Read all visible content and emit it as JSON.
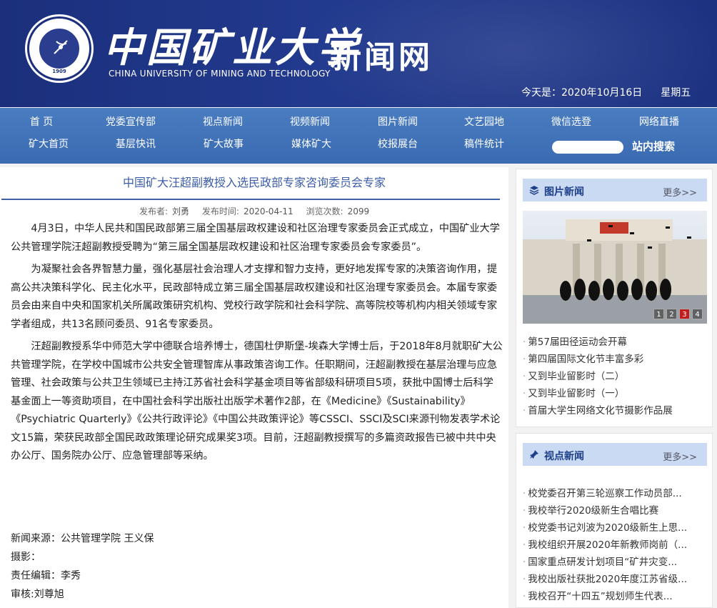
{
  "header": {
    "logo_cn": "中国矿业大学",
    "logo_en": "CHINA UNIVERSITY OF MINING AND TECHNOLOGY",
    "seal_year": "1909",
    "site_name": "新闻网",
    "date_prefix": "今天是：2020年10月16日",
    "weekday": "星期五"
  },
  "nav": {
    "row1": [
      "首 页",
      "党委宣传部",
      "视点新闻",
      "视频新闻",
      "图片新闻",
      "文艺园地",
      "微信选登",
      "网络直播"
    ],
    "row2": [
      "矿大首页",
      "基层快讯",
      "矿大故事",
      "媒体矿大",
      "校报展台",
      "稿件统计"
    ],
    "search_placeholder": "",
    "search_label": "站内搜索"
  },
  "article": {
    "title": "中国矿大汪超副教授入选民政部专家咨询委员会专家",
    "meta": {
      "author_label": "发布者:",
      "author": "刘勇",
      "time_label": "发布时间:",
      "time": "2020-04-11",
      "views_label": "浏览次数:",
      "views": "2099"
    },
    "paragraphs": [
      "4月3日，中华人民共和国民政部第三届全国基层政权建设和社区治理专家委员会正式成立，中国矿业大学公共管理学院汪超副教授受聘为“第三届全国基层政权建设和社区治理专家委员会专家委员”。",
      "为凝聚社会各界智慧力量，强化基层社会治理人才支撑和智力支持，更好地发挥专家的决策咨询作用，提高公共决策科学化、民主化水平，民政部特成立第三届全国基层政权建设和社区治理专家委员会。本届专家委员会由来自中央和国家机关所属政策研究机构、党校行政学院和社会科学院、高等院校等机构内相关领域专家学者组成，共13名顾问委员、91名专家委员。",
      "汪超副教授系华中师范大学中德联合培养博士，德国杜伊斯堡-埃森大学博士后，于2018年8月就职矿大公共管理学院，在学校中国城市公共安全管理智库从事政策咨询工作。任职期间，汪超副教授在基层治理与应急管理、社会政策与公共卫生领域已主持江苏省社会科学基金项目等省部级科研项目5项，获批中国博士后科学基金面上一等资助项目，在中国社会科学出版社出版学术著作2部，在《Medicine》《Sustainability》《Psychiatric Quarterly》《公共行政评论》《中国公共政策评论》等CSSCI、SSCI及SCI来源刊物发表学术论文15篇，荣获民政部全国民政政策理论研究成果奖3项。目前，汪超副教授撰写的多篇资政报告已被中共中央办公厅、国务院办公厅、应急管理部等采纳。"
    ],
    "credits": {
      "source": "新闻来源：公共管理学院 王义保",
      "photo": "摄影：",
      "editor": "责任编辑：李秀",
      "review": "审核:刘尊旭"
    }
  },
  "sidebar": {
    "photo_news": {
      "title": "图片新闻",
      "more": "更多>>",
      "pager": [
        "1",
        "2",
        "3",
        "4"
      ],
      "active_page": 3,
      "items": [
        "第57届田径运动会开幕",
        "第四届国际文化节丰富多彩",
        "又到毕业留影时（二）",
        "又到毕业留影时（一）",
        "首届大学生网络文化节摄影作品展"
      ]
    },
    "viewpoint_news": {
      "title": "视点新闻",
      "more": "更多>>",
      "items": [
        "校党委召开第三轮巡察工作动员部...",
        "我校举行2020级新生合唱比赛",
        "校党委书记刘波为2020级新生上思...",
        "我校组织开展2020年新教师岗前（...",
        "国家重点研发计划项目“矿井灾变...",
        "我校出版社获批2020年度江苏省级...",
        "我校召开“十四五”规划师生代表..."
      ]
    }
  },
  "colors": {
    "header_bg": "#1b2f7c",
    "nav_bg": "#3a6bb2",
    "title_color": "#3c5ea8",
    "panel_head_bg": "#c9daf2",
    "pager_active": "#c21c1c"
  }
}
